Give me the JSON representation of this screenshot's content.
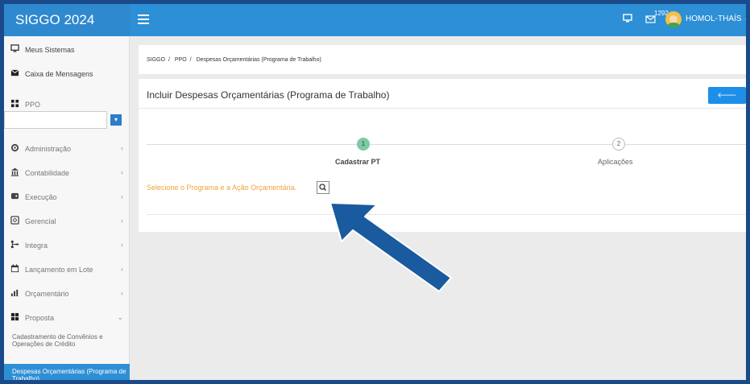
{
  "app": {
    "title": "SIGGO 2024"
  },
  "topbar": {
    "message_count": "1292",
    "username": "HOMOL-THAÍS ⌄"
  },
  "sidebar": {
    "items": [
      {
        "label": "Meus Sistemas",
        "icon": "monitor-icon"
      },
      {
        "label": "Caixa de Mensagens",
        "icon": "envelope-icon"
      },
      {
        "label": "PPO",
        "icon": "grid-icon"
      },
      {
        "label": "Administração",
        "icon": "gears-icon"
      },
      {
        "label": "Contabilidade",
        "icon": "bank-icon"
      },
      {
        "label": "Execução",
        "icon": "wallet-icon"
      },
      {
        "label": "Gerencial",
        "icon": "report-icon"
      },
      {
        "label": "Integra",
        "icon": "sitemap-icon"
      },
      {
        "label": "Lançamento em Lote",
        "icon": "calendar-icon"
      },
      {
        "label": "Orçamentário",
        "icon": "chart-icon"
      },
      {
        "label": "Proposta",
        "icon": "blocks-icon"
      }
    ],
    "sub_items": [
      "Cadastramento de Convênios e Operações de Crédito",
      "Despesas Orçamentárias (Programa de Trabalho)"
    ],
    "ppo_select_value": "",
    "ppo_button": "▾"
  },
  "breadcrumb": [
    "SIGGO",
    "PPO",
    "Despesas Orçamentárias (Programa de Trabalho)"
  ],
  "panel": {
    "title": "Incluir Despesas Orçamentárias (Programa de Trabalho)",
    "back_button": "Voltar",
    "steps": [
      {
        "number": "1",
        "label": "Cadastrar PT",
        "active": true
      },
      {
        "number": "2",
        "label": "Aplicações",
        "active": false
      }
    ],
    "prompt": "Selecione o Programa e a Ação Orçamentária."
  },
  "colors": {
    "topbar": "#2d8fd5",
    "accent": "#1e8fe8",
    "prompt": "#f0a43a",
    "step_active": "#7ec9a3",
    "annotation_arrow": "#1a5a9e"
  }
}
